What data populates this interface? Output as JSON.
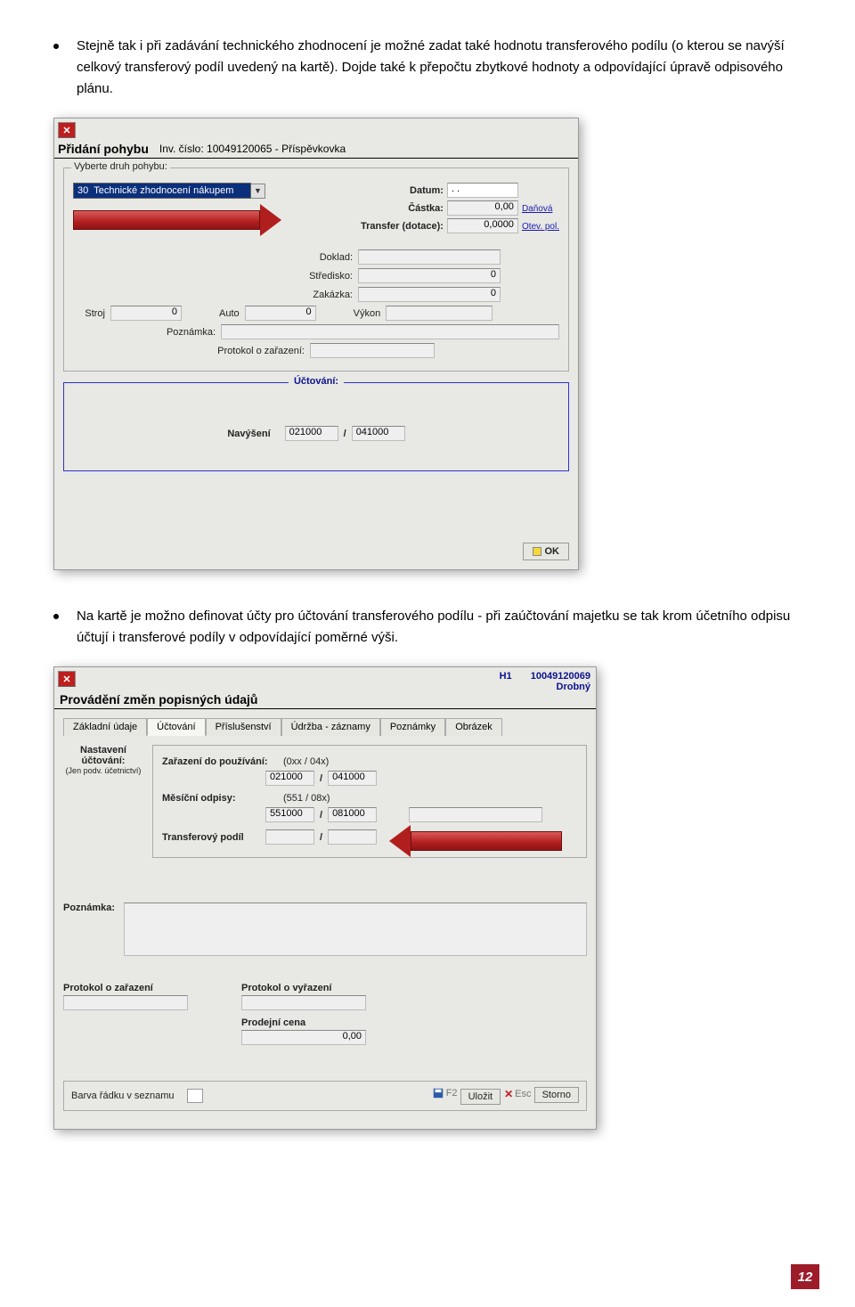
{
  "paragraph1": "Stejně tak i při zadávání technického zhodnocení je možné zadat také hodnotu transferového podílu (o kterou se navýší celkový transferový podíl uvedený na kartě). Dojde také k přepočtu zbytkové hodnoty a odpovídající úpravě odpisového plánu.",
  "screenshot1": {
    "title_prefix": "Přidání pohybu",
    "inv_label": "Inv. číslo: 10049120065  -  Příspěvkovka",
    "select_label": "Vyberte druh pohybu:",
    "select_code": "30",
    "select_value": "Technické zhodnocení nákupem",
    "labels": {
      "datum": "Datum:",
      "castka": "Částka:",
      "transfer": "Transfer (dotace):",
      "doklad": "Doklad:",
      "stredisko": "Středisko:",
      "zakazka": "Zakázka:",
      "stroj": "Stroj",
      "auto": "Auto",
      "vykon": "Výkon",
      "poznamka": "Poznámka:",
      "protokol": "Protokol o zařazení:"
    },
    "values": {
      "datum": ". .",
      "castka": "0,00",
      "transfer": "0,0000",
      "stredisko": "0",
      "zakazka": "0",
      "stroj": "0",
      "auto": "0"
    },
    "links": {
      "danova": "Daňová",
      "otevpol": "Otev. pol."
    },
    "accounting": {
      "legend": "Účtování:",
      "row_label": "Navýšení",
      "acc1": "021000",
      "slash": "/",
      "acc2": "041000"
    },
    "ok": "OK"
  },
  "paragraph2": "Na kartě je možno definovat účty pro účtování transferového podílu - při zaúčtování majetku se tak krom účetního odpisu účtují i transferové podíly v odpovídající poměrné výši.",
  "screenshot2": {
    "header_right": {
      "code_label": "H1",
      "code": "10049120069",
      "type": "Drobný"
    },
    "title": "Provádění změn popisných údajů",
    "tabs": [
      "Základní údaje",
      "Účtování",
      "Příslušenství",
      "Údržba - záznamy",
      "Poznámky",
      "Obrázek"
    ],
    "active_tab_index": 1,
    "side_label1": "Nastavení účtování:",
    "side_label2": "(Jen podv. účetnictví)",
    "rows": {
      "zarazeni_label": "Zařazení do používání:",
      "zarazeni_hint": "(0xx / 04x)",
      "zarazeni_a": "021000",
      "zarazeni_b": "041000",
      "odpisy_label": "Měsíční odpisy:",
      "odpisy_hint": "(551 / 08x)",
      "odpisy_a": "551000",
      "odpisy_b": "081000",
      "transfer_label": "Transferový podíl",
      "slash": "/"
    },
    "poznamka_label": "Poznámka:",
    "protokol_z": "Protokol o zařazení",
    "protokol_v": "Protokol o vyřazení",
    "prodejni": "Prodejní cena",
    "prodejni_val": "0,00",
    "barva": "Barva řádku v seznamu",
    "buttons": {
      "ulozit": "Uložit",
      "ulozit_key": "F2",
      "storno": "Storno",
      "storno_key": "Esc"
    }
  },
  "page_number": "12"
}
